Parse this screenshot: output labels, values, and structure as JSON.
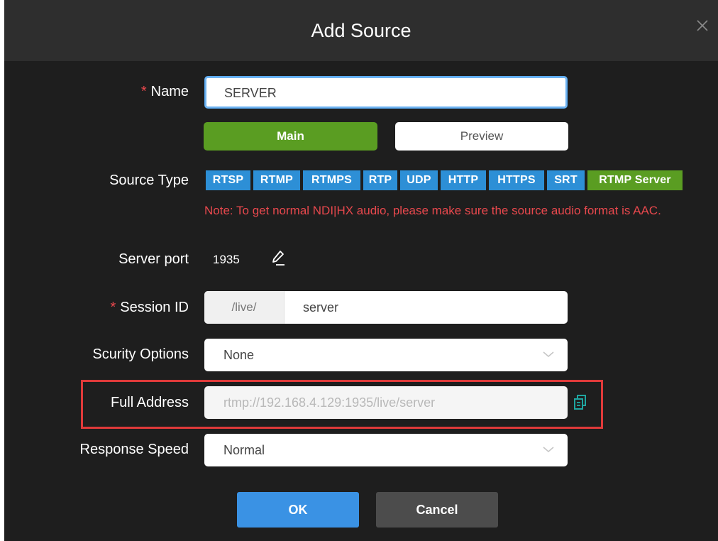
{
  "dialog": {
    "title": "Add Source",
    "close_icon": "close-icon"
  },
  "name": {
    "required_mark": "*",
    "label": "Name",
    "value": "SERVER"
  },
  "stream_tabs": {
    "main_label": "Main",
    "preview_label": "Preview",
    "selected": "Main"
  },
  "source_type": {
    "label": "Source Type",
    "options": [
      "RTSP",
      "RTMP",
      "RTMPS",
      "RTP",
      "UDP",
      "HTTP",
      "HTTPS",
      "SRT",
      "RTMP Server"
    ],
    "selected": "RTMP Server",
    "note": "Note: To get normal NDI|HX audio, please make sure the source audio format is AAC."
  },
  "server_port": {
    "label": "Server port",
    "value": "1935",
    "edit_icon": "pencil-icon"
  },
  "session_id": {
    "required_mark": "*",
    "label": "Session ID",
    "prefix": "/live/",
    "value": "server"
  },
  "security": {
    "label": "Scurity Options",
    "value": "None"
  },
  "full_address": {
    "label": "Full Address",
    "value": "rtmp://192.168.4.129:1935/live/server",
    "copy_icon": "copy-icon"
  },
  "response_speed": {
    "label": "Response Speed",
    "value": "Normal"
  },
  "buttons": {
    "ok_label": "OK",
    "cancel_label": "Cancel"
  },
  "colors": {
    "dialog_bg": "#1e1e1e",
    "titlebar_bg": "#2e2e2e",
    "accent_blue": "#2d8fd6",
    "accent_green": "#5a9d22",
    "note_red": "#e8484d",
    "highlight_red": "#e03a3a"
  }
}
